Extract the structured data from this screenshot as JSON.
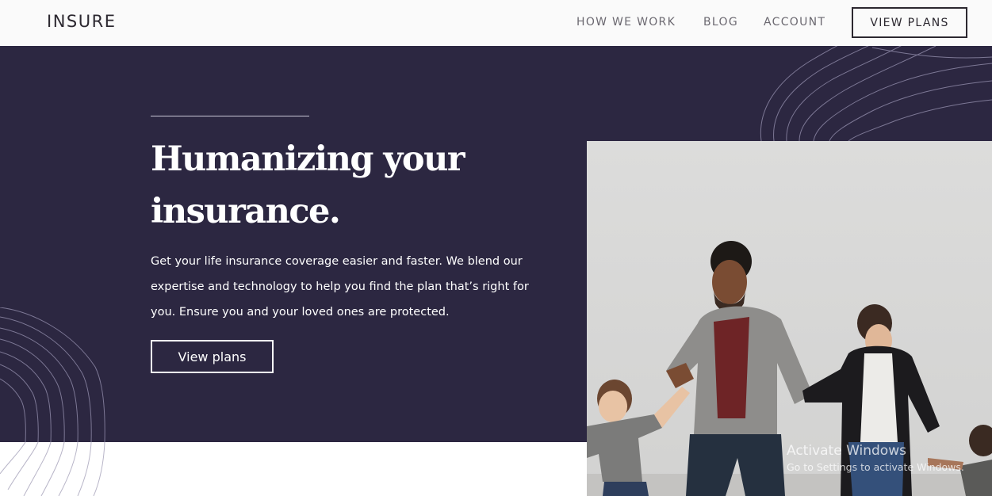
{
  "brand": {
    "logo_text": "INSURE"
  },
  "nav": {
    "links": [
      "HOW WE WORK",
      "BLOG",
      "ACCOUNT"
    ],
    "cta_label": "VIEW PLANS"
  },
  "hero": {
    "title": "Humanizing your insurance.",
    "body": "Get your life insurance coverage easier and faster. We blend our expertise and technology to help you find the plan that’s right for you. Ensure you and your loved ones are protected.",
    "cta_label": "View plans"
  },
  "watermark": {
    "title": "Activate Windows",
    "subtitle": "Go to Settings to activate Windows."
  },
  "colors": {
    "hero_background": "#2c2741",
    "navbar_background": "#fafafa",
    "text_dark": "#2c2830",
    "nav_text": "#6b6870"
  }
}
